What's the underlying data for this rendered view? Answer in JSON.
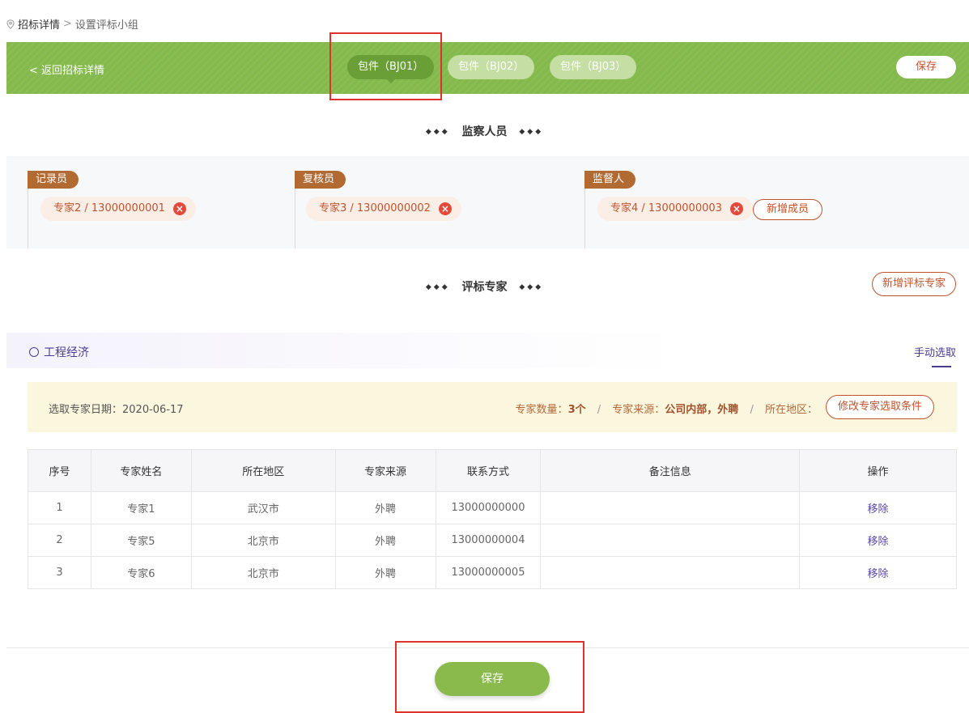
{
  "breadcrumb": {
    "parent": "招标详情",
    "separator": ">",
    "current": "设置评标小组"
  },
  "topbar": {
    "back_label": "< 返回招标详情",
    "packages": [
      {
        "label": "包件（BJ01）",
        "active": true
      },
      {
        "label": "包件（BJ02）",
        "active": false
      },
      {
        "label": "包件（BJ03）",
        "active": false
      }
    ],
    "save_label": "保存"
  },
  "supervision": {
    "title": "监察人员",
    "roles": [
      {
        "tag": "记录员",
        "members": [
          "专家2 / 13000000001"
        ]
      },
      {
        "tag": "复核员",
        "members": [
          "专家3 / 13000000002"
        ]
      },
      {
        "tag": "监督人",
        "members": [
          "专家4 / 13000000003"
        ]
      }
    ],
    "add_member_label": "新增成员",
    "remove_icon": "×"
  },
  "experts_section": {
    "title": "评标专家",
    "add_label": "新增评标专家"
  },
  "group": {
    "title": "工程经济",
    "manual_select_label": "手动选取"
  },
  "criteria": {
    "date_label": "选取专家日期：2020-06-17",
    "count_label": "专家数量：",
    "count_value": "3个",
    "source_label": "专家来源：",
    "source_value": "公司内部，外聘",
    "region_label": "所在地区：",
    "separator": "/",
    "modify_label": "修改专家选取条件"
  },
  "table": {
    "headers": [
      "序号",
      "专家姓名",
      "所在地区",
      "专家来源",
      "联系方式",
      "备注信息",
      "操作"
    ],
    "rows": [
      {
        "no": "1",
        "name": "专家1",
        "region": "武汉市",
        "source": "外聘",
        "phone": "13000000000",
        "note": "",
        "action": "移除"
      },
      {
        "no": "2",
        "name": "专家5",
        "region": "北京市",
        "source": "外聘",
        "phone": "13000000004",
        "note": "",
        "action": "移除"
      },
      {
        "no": "3",
        "name": "专家6",
        "region": "北京市",
        "source": "外聘",
        "phone": "13000000005",
        "note": "",
        "action": "移除"
      }
    ]
  },
  "footer": {
    "save_label": "保存"
  },
  "colors": {
    "brand_green": "#84b94b",
    "accent_orange": "#c0532e",
    "role_tag_brown": "#b26a33",
    "purple": "#4b3b8f",
    "highlight_red": "#e0322d"
  },
  "icons": {
    "breadcrumb": "location-pin-icon",
    "remove": "close-circle-icon",
    "section_dots": "diamond-dots-icon",
    "group": "circle-icon"
  }
}
